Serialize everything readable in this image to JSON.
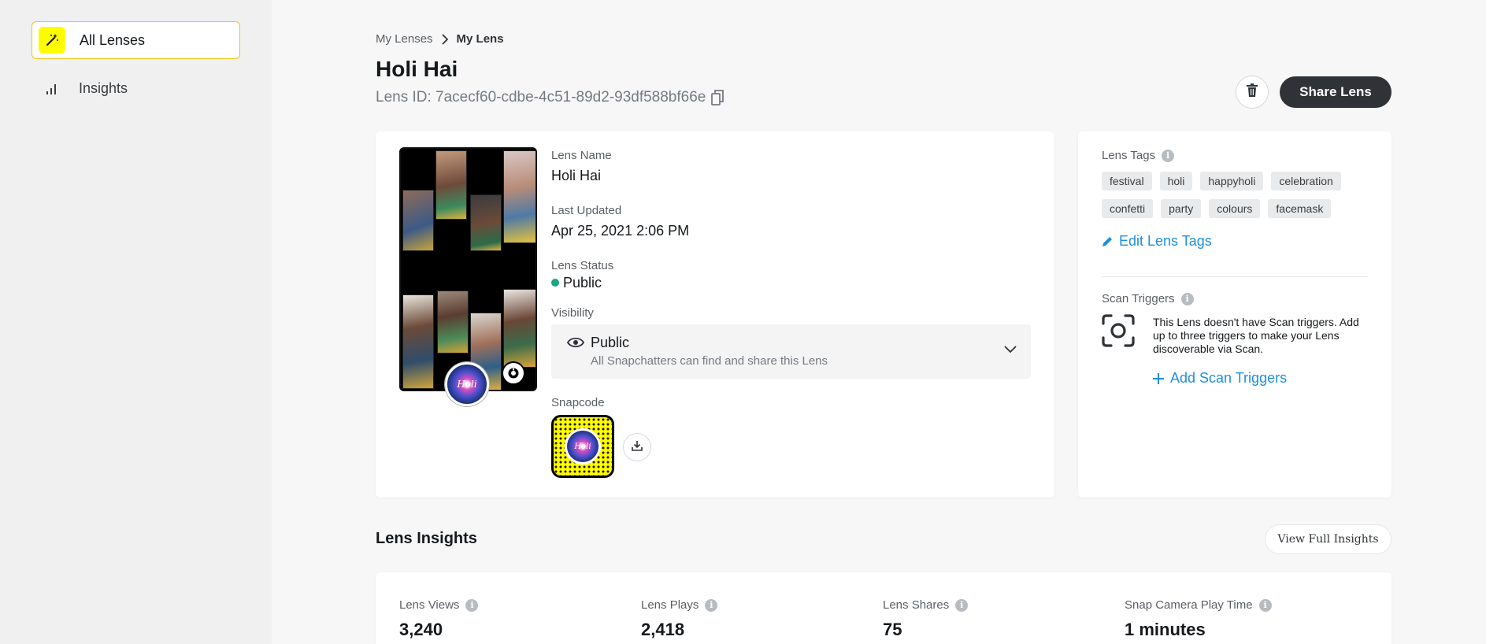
{
  "sidebar": {
    "items": [
      {
        "label": "All Lenses",
        "icon": "magic-wand-icon",
        "active": true
      },
      {
        "label": "Insights",
        "icon": "bar-chart-icon",
        "active": false
      }
    ]
  },
  "breadcrumb": {
    "parent": "My Lenses",
    "current": "My Lens"
  },
  "header": {
    "title": "Holi Hai",
    "lens_id": "Lens ID: 7acecf60-cdbe-4c51-89d2-93df588bf66e",
    "share_label": "Share Lens"
  },
  "details": {
    "name_label": "Lens Name",
    "name_value": "Holi Hai",
    "updated_label": "Last Updated",
    "updated_value": "Apr 25, 2021 2:06 PM",
    "status_label": "Lens Status",
    "status_value": "Public",
    "status_color": "#1aa583",
    "visibility_label": "Visibility",
    "visibility_value": "Public",
    "visibility_desc": "All Snapchatters can find and share this Lens",
    "snapcode_label": "Snapcode",
    "preview_badge": "Holi"
  },
  "tags": {
    "label": "Lens Tags",
    "items": [
      "festival",
      "holi",
      "happyholi",
      "celebration",
      "confetti",
      "party",
      "colours",
      "facemask"
    ],
    "edit_label": "Edit Lens Tags"
  },
  "scan": {
    "label": "Scan Triggers",
    "description": "This Lens doesn't have Scan triggers. Add up to three triggers to make your Lens discoverable via Scan.",
    "add_label": "Add Scan Triggers"
  },
  "insights": {
    "title": "Lens Insights",
    "view_full_label": "View Full Insights",
    "stats": [
      {
        "label": "Lens Views",
        "value": "3,240"
      },
      {
        "label": "Lens Plays",
        "value": "2,418"
      },
      {
        "label": "Lens Shares",
        "value": "75"
      },
      {
        "label": "Snap Camera Play Time",
        "value": "1 minutes"
      }
    ]
  },
  "colors": {
    "accent": "#fffc00",
    "link": "#1e8fdf",
    "dark_button": "#2f3236"
  }
}
